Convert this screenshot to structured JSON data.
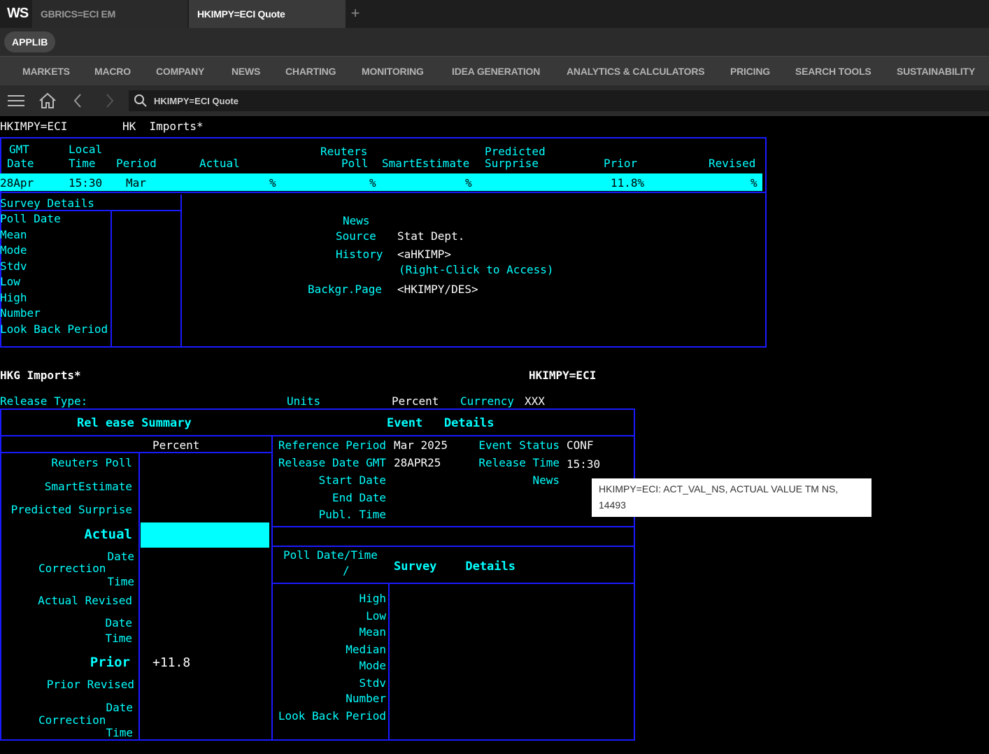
{
  "app": {
    "logo": "WS"
  },
  "tabs": [
    {
      "label": "GBRICS=ECI EM"
    },
    {
      "label": "HKIMPY=ECI Quote"
    }
  ],
  "applib_label": "APPLIB",
  "menu": [
    "MARKETS",
    "MACRO",
    "COMPANY",
    "NEWS",
    "CHARTING",
    "MONITORING",
    "IDEA GENERATION",
    "ANALYTICS & CALCULATORS",
    "PRICING",
    "SEARCH TOOLS",
    "SUSTAINABILITY"
  ],
  "search": {
    "value": "HKIMPY=ECI Quote"
  },
  "quote": {
    "ric": "HKIMPY=ECI",
    "title": "HK  Imports*",
    "headers": {
      "gmt": "GMT",
      "date": "Date",
      "local": "Local",
      "time": "Time",
      "period": "Period",
      "actual": "Actual",
      "reuters": "Reuters",
      "poll": "Poll",
      "smart": "SmartEstimate",
      "predicted": "Predicted",
      "surprise": "Surprise",
      "prior": "Prior",
      "revised": "Revised"
    },
    "row": {
      "date": "28Apr",
      "time": "15:30",
      "period": "Mar",
      "actual": "%",
      "poll": "%",
      "smart": "%",
      "prior": "11.8%",
      "revised": "%"
    },
    "survey_title": "Survey Details",
    "survey_labels": [
      "Poll Date",
      "Mean",
      "Mode",
      "Stdv",
      "Low",
      "High",
      "Number",
      "Look Back Period"
    ],
    "info": {
      "news_label": "News",
      "source_label": "Source",
      "source_value": "Stat Dept.",
      "history_label": "History",
      "history_value": "<aHKIMP>",
      "right_click": "(Right-Click to Access)",
      "backgr_label": "Backgr.Page",
      "backgr_value": "<HKIMPY/DES>"
    }
  },
  "detail": {
    "title": "HKG Imports*",
    "ric": "HKIMPY=ECI",
    "release_type_label": "Release Type:",
    "units_label": "Units",
    "units_value": "Percent",
    "currency_label": "Currency",
    "currency_value": "XXX",
    "release_summary": "Rel ease Summary",
    "event_details": "Event   Details",
    "percent": "Percent",
    "left_labels": {
      "reuters_poll": "Reuters Poll",
      "smart": "SmartEstimate",
      "predicted": "Predicted Surprise",
      "actual": "Actual",
      "date1": "Date",
      "correction1": "Correction",
      "time1": "Time",
      "actual_revised": "Actual Revised",
      "date2": "Date",
      "time2": "Time",
      "prior": "Prior",
      "prior_value": "+11.8",
      "prior_revised": "Prior Revised",
      "date3": "Date",
      "correction2": "Correction",
      "time3": "Time"
    },
    "event": {
      "ref_label": "Reference Period",
      "ref_value": "Mar 2025",
      "status_label": "Event Status",
      "status_value": "CONF",
      "release_date_label": "Release Date GMT",
      "release_date_value": "28APR25",
      "release_time_label": "Release Time",
      "release_time_value": "15:30",
      "start_label": "Start Date",
      "news_label": "News",
      "end_label": "End Date",
      "publ_label": "Publ. Time"
    },
    "poll_header": "Poll Date/Time",
    "poll_slash": "/",
    "survey_details": "Survey    Details",
    "survey_labels": [
      "High",
      "Low",
      "Mean",
      "Median",
      "Mode",
      "Stdv",
      "Number",
      "Look Back Period"
    ]
  },
  "tooltip": {
    "line1": "HKIMPY=ECI: ACT_VAL_NS, ACTUAL VALUE TM NS,",
    "line2": "14493"
  },
  "colors": {
    "accent": "#00ffff",
    "border": "#1a1aff",
    "background": "#000000"
  }
}
